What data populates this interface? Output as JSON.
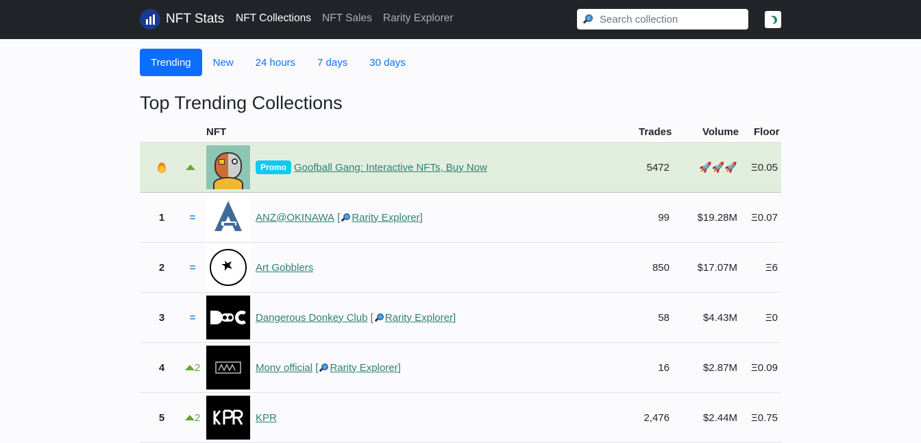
{
  "navbar": {
    "brand": "NFT Stats",
    "links": [
      "NFT Collections",
      "NFT Sales",
      "Rarity Explorer"
    ],
    "search_placeholder": "Search collection"
  },
  "tabs": [
    "Trending",
    "New",
    "24 hours",
    "7 days",
    "30 days"
  ],
  "heading": "Top Trending Collections",
  "table": {
    "headers": {
      "nft": "NFT",
      "trades": "Trades",
      "volume": "Volume",
      "floor": "Floor"
    },
    "promo": {
      "badge": "Promo",
      "name": "Goofball Gang: Interactive NFTs, Buy Now",
      "trades": "5472",
      "volume": "🚀🚀🚀",
      "floor": "Ξ0.05"
    },
    "rarity_label": "Rarity Explorer",
    "rows": [
      {
        "rank": "1",
        "change": "=",
        "name": "ANZ@OKINAWA",
        "trades": "99",
        "volume": "$19.28M",
        "floor": "Ξ0.07"
      },
      {
        "rank": "2",
        "change": "=",
        "name": "Art Gobblers",
        "trades": "850",
        "volume": "$17.07M",
        "floor": "Ξ6"
      },
      {
        "rank": "3",
        "change": "=",
        "name": "Dangerous Donkey Club",
        "trades": "58",
        "volume": "$4.43M",
        "floor": "Ξ0"
      },
      {
        "rank": "4",
        "change": "2",
        "name": "Mony official",
        "trades": "16",
        "volume": "$2.87M",
        "floor": "Ξ0.09"
      },
      {
        "rank": "5",
        "change": "2",
        "name": "KPR",
        "trades": "2,476",
        "volume": "$2.44M",
        "floor": "Ξ0.75"
      }
    ]
  }
}
